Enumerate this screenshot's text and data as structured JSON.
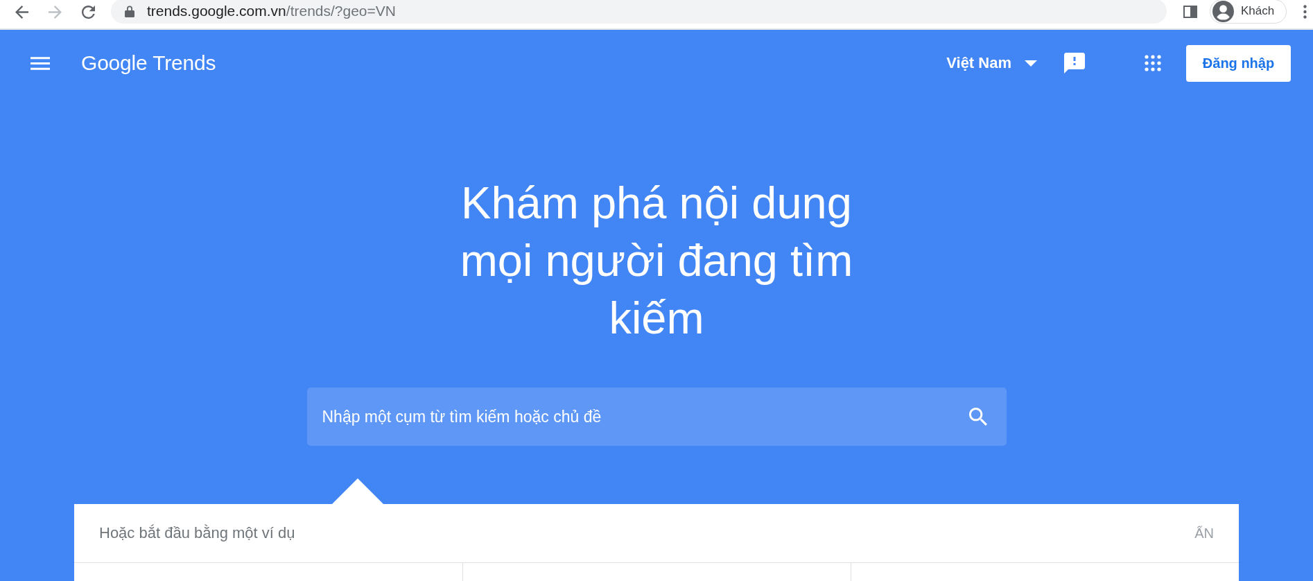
{
  "browser": {
    "forward_disabled": true,
    "url": {
      "host": "trends.google.com.vn",
      "path": "/trends/?geo=VN"
    },
    "profile": "Khách"
  },
  "header": {
    "logo": "Google Trends",
    "region": "Việt Nam",
    "sign_in": "Đăng nhập"
  },
  "hero": {
    "title": "Khám phá nội dung mọi người đang tìm kiếm",
    "search": {
      "placeholder": "Nhập một cụm từ tìm kiếm hoặc chủ đề"
    }
  },
  "examples": {
    "title": "Hoặc bắt đầu bằng một ví dụ",
    "hide": "ẨN"
  }
}
